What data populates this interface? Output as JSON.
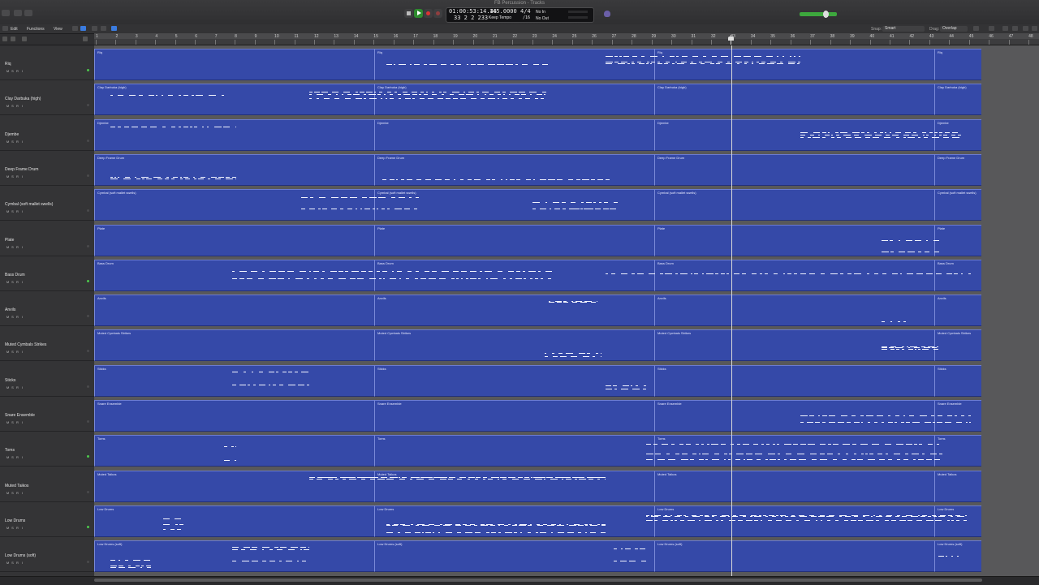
{
  "window": {
    "title": "FB Percussion - Tracks"
  },
  "lcd": {
    "time": "01:00:53:14.46",
    "bars": "33  2  2  233",
    "tempo": "145.0000",
    "tempo_mode": "Keep Tempo",
    "signature": "4/4",
    "division": "/16",
    "midi_in": "No In",
    "midi_out": "No Out"
  },
  "menu": {
    "edit": "Edit",
    "functions": "Functions",
    "view": "View"
  },
  "toolbar": {
    "snap_label": "Snap:",
    "snap_value": "Smart",
    "drag_label": "Drag:",
    "drag_value": "Overlap"
  },
  "ruler": {
    "bars": [
      "1",
      "2",
      "3",
      "4",
      "5",
      "6",
      "7",
      "8",
      "9",
      "10",
      "11",
      "12",
      "13",
      "14",
      "15",
      "16",
      "17",
      "18",
      "19",
      "20",
      "21",
      "22",
      "23",
      "24",
      "25",
      "26",
      "27",
      "28",
      "29",
      "30",
      "31",
      "32",
      "33",
      "34",
      "35",
      "36",
      "37",
      "38",
      "39",
      "40",
      "41",
      "42",
      "43",
      "44",
      "45",
      "46",
      "47",
      "48"
    ]
  },
  "ms_labels": {
    "mute": "M",
    "solo": "S",
    "rec": "R",
    "input": "I"
  },
  "tracks": [
    {
      "name": "Riq",
      "led": true
    },
    {
      "name": "Clay Darbuka (high)",
      "led": false
    },
    {
      "name": "Djembe",
      "led": false
    },
    {
      "name": "Deep Frame Drum",
      "led": false
    },
    {
      "name": "Cymbal (soft mallet swells)",
      "led": false
    },
    {
      "name": "Plate",
      "led": false
    },
    {
      "name": "Bass Drum",
      "led": true
    },
    {
      "name": "Anvils",
      "led": false
    },
    {
      "name": "Muted Cymbals Strikes",
      "led": false
    },
    {
      "name": "Sticks",
      "led": false
    },
    {
      "name": "Snare Ensemble",
      "led": false
    },
    {
      "name": "Toms",
      "led": true
    },
    {
      "name": "Muted Taikos",
      "led": false
    },
    {
      "name": "Low Drums",
      "led": true
    },
    {
      "name": "Low Drums (soft)",
      "led": false
    }
  ],
  "colors": {
    "region": "#3549a8",
    "note": "#f2f4ff",
    "led_on": "#4cc64c"
  }
}
